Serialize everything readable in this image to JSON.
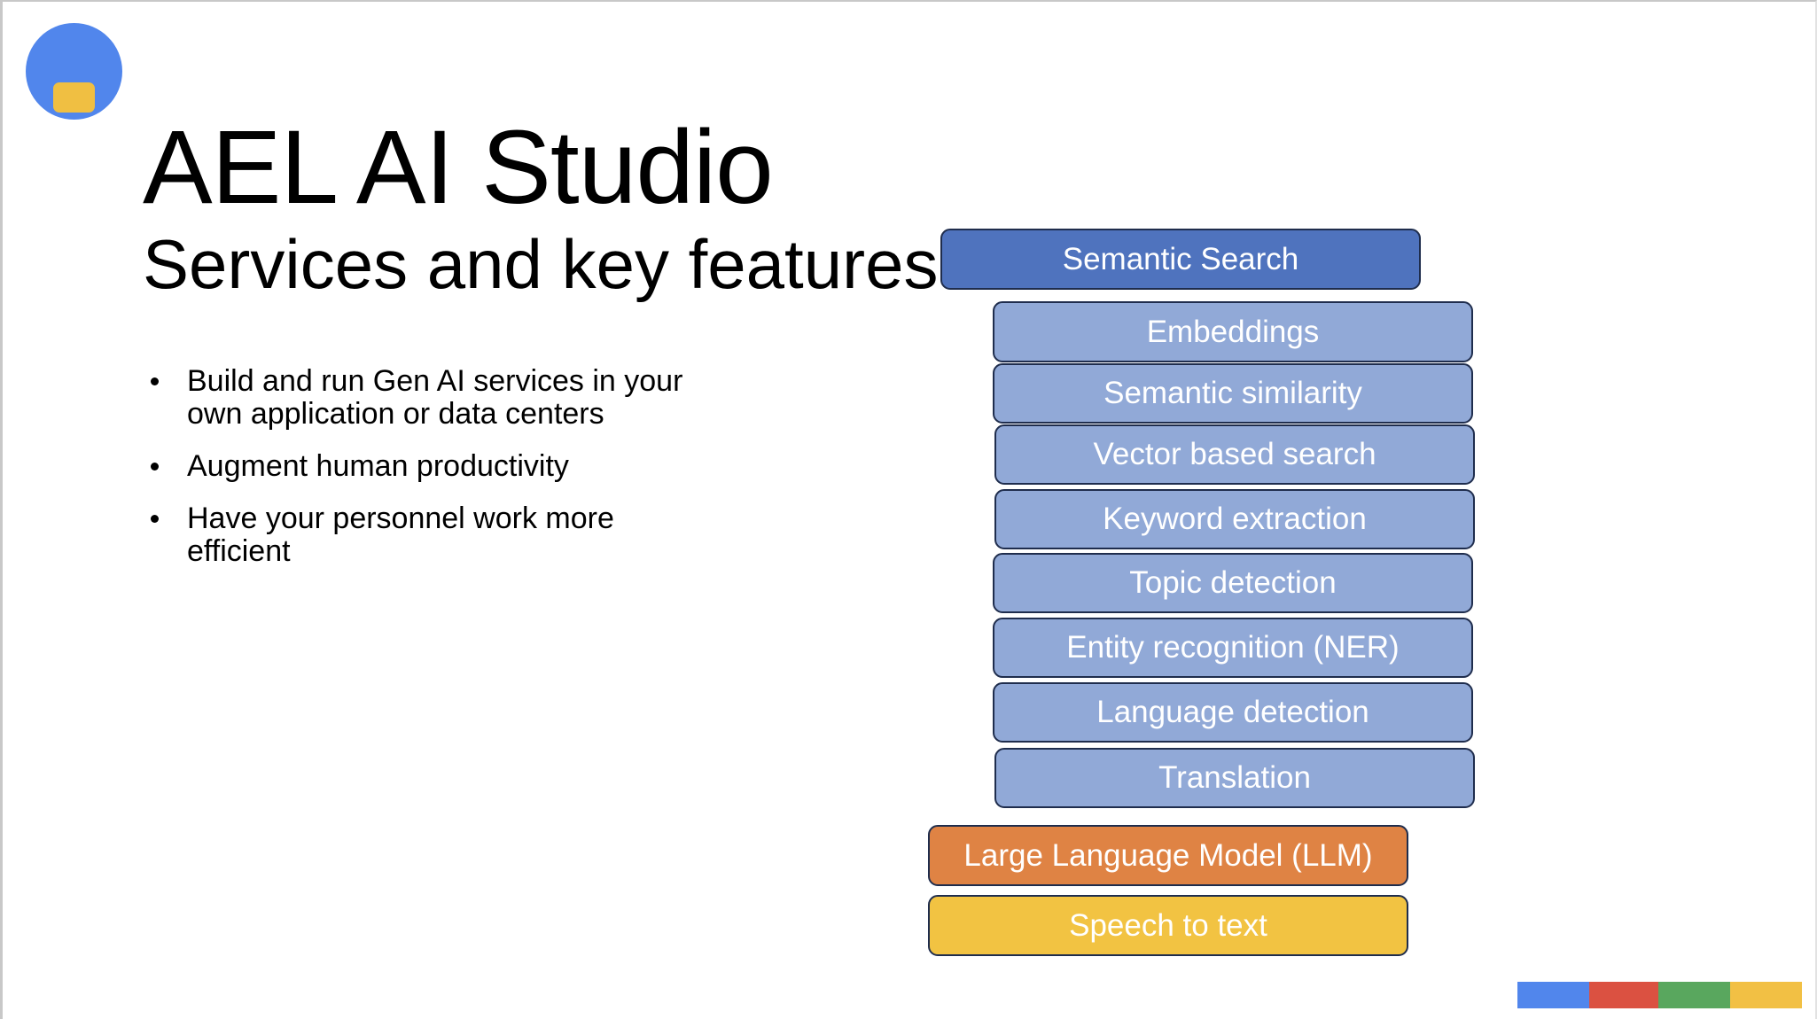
{
  "slide": {
    "title": "AEL AI Studio",
    "subtitle": "Services and key features",
    "bullets": [
      "Build and run Gen AI services in your own application or data centers",
      "Augment human productivity",
      "Have your personnel work more efficient"
    ]
  },
  "logo": {
    "icon": "logo-circle-icon",
    "outer_color": "#5186ec",
    "inner_color": "#f0bf42"
  },
  "diagram": {
    "primary": {
      "label": "Semantic Search",
      "color": "#4f73be"
    },
    "features": [
      "Embeddings",
      "Semantic similarity",
      "Vector based search",
      "Keyword extraction",
      "Topic detection",
      "Entity recognition (NER)",
      "Language detection",
      "Translation"
    ],
    "feature_color": "#91a9d7",
    "llm": {
      "label": "Large Language Model (LLM)",
      "color": "#df8344"
    },
    "speech": {
      "label": "Speech to text",
      "color": "#f2c342"
    }
  },
  "footer": {
    "colors": [
      "#5186ec",
      "#db5141",
      "#59a75e",
      "#f2c044"
    ]
  }
}
